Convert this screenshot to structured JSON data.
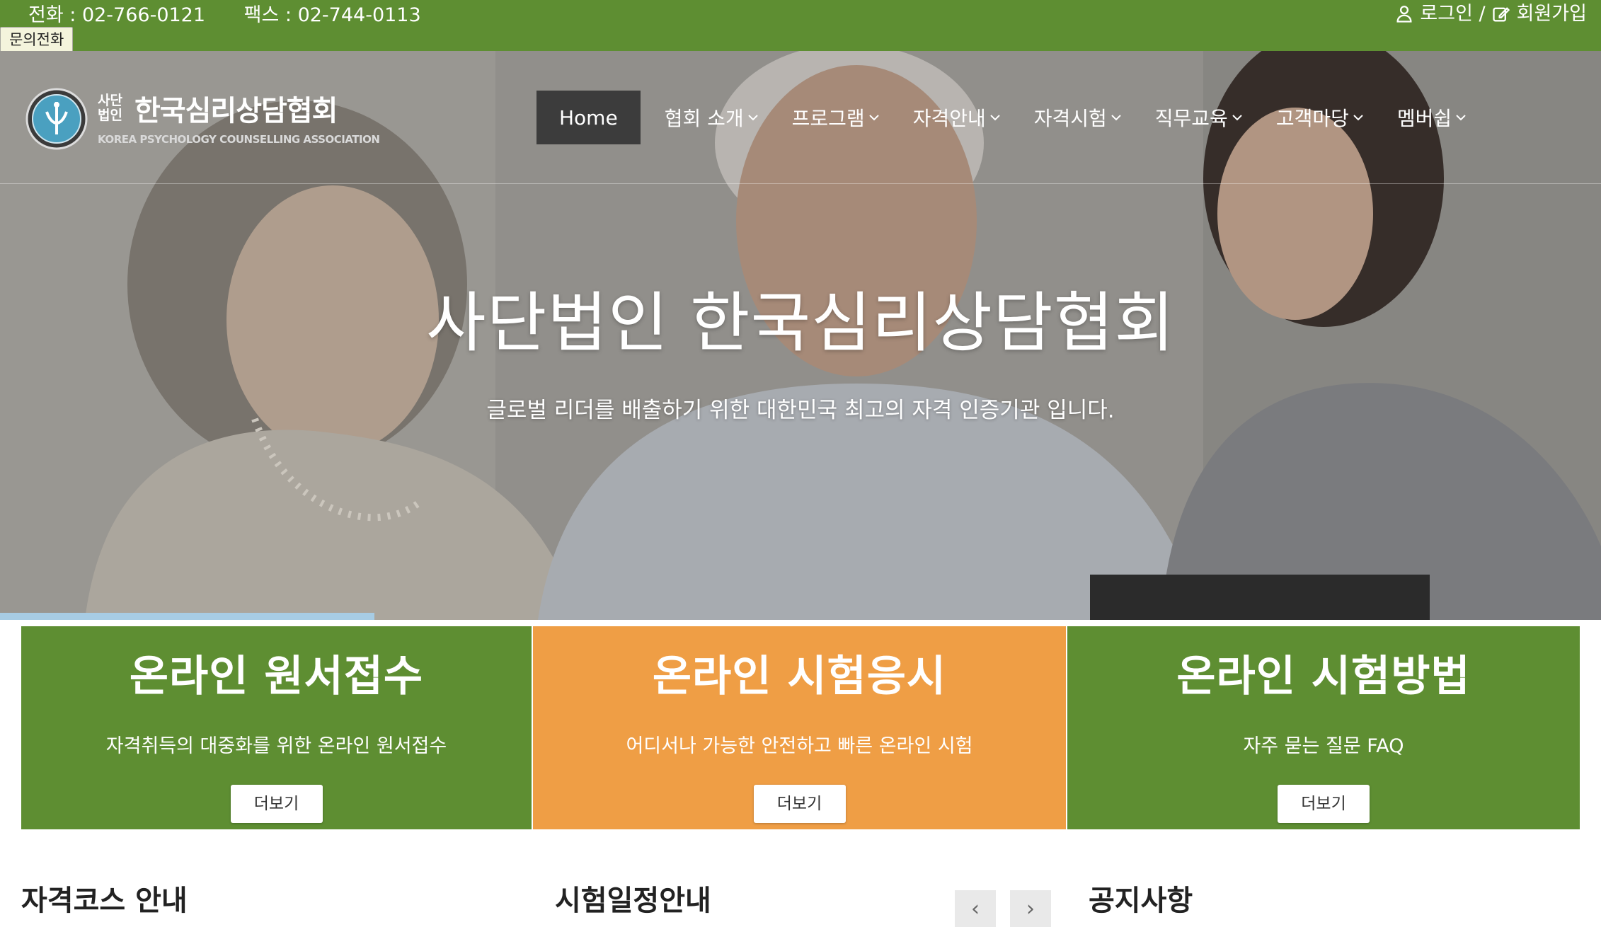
{
  "topbar": {
    "phone": "전화 : 02-766-0121",
    "fax": "팩스 : 02-744-0113",
    "login": "로그인 /",
    "signup": "회원가입",
    "tooltip": "문의전화"
  },
  "logo": {
    "small_line": "사단법인",
    "name": "한국심리상담협회",
    "english": "KOREA PSYCHOLOGY COUNSELLING ASSOCIATION"
  },
  "nav": {
    "items": [
      {
        "label": "Home",
        "active": true
      },
      {
        "label": "협회 소개",
        "dropdown": true
      },
      {
        "label": "프로그램",
        "dropdown": true
      },
      {
        "label": "자격안내",
        "dropdown": true
      },
      {
        "label": "자격시험",
        "dropdown": true
      },
      {
        "label": "직무교육",
        "dropdown": true
      },
      {
        "label": "고객마당",
        "dropdown": true
      },
      {
        "label": "멤버쉽",
        "dropdown": true
      }
    ]
  },
  "hero": {
    "headline": "사단법인 한국심리상담협회",
    "subline": "글로벌 리더를 배출하기 위한 대한민국 최고의 자격 인증기관 입니다.",
    "slide_progress": 0.234
  },
  "features": [
    {
      "title": "온라인 원서접수",
      "desc": "자격취득의 대중화를 위한 온라인 원서접수",
      "button": "더보기",
      "color": "#5e8e32"
    },
    {
      "title": "온라인 시험응시",
      "desc": "어디서나 가능한 안전하고 빠른 온라인 시험",
      "button": "더보기",
      "color": "#ef9e45"
    },
    {
      "title": "온라인 시험방법",
      "desc": "자주 묻는 질문 FAQ",
      "button": "더보기",
      "color": "#5e8e32"
    }
  ],
  "sections": {
    "courses": "자격코스 안내",
    "schedule": "시험일정안내",
    "notices": "공지사항",
    "prev": "‹",
    "next": "›"
  },
  "colors": {
    "brand_green": "#5e8e32",
    "accent_orange": "#ef9e45",
    "nav_active": "#3c3c3c",
    "progress": "#a7cce4"
  }
}
